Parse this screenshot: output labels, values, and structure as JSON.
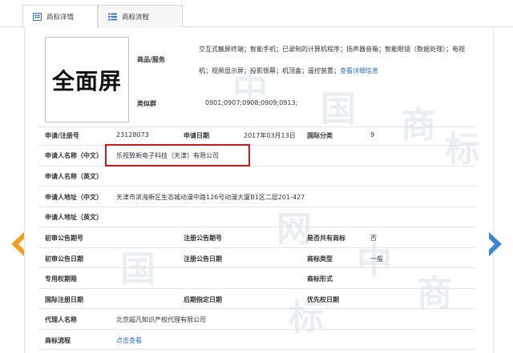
{
  "tabs": {
    "detail": "商标详情",
    "flow": "商标流程"
  },
  "logo_text": "全面屏",
  "watermark_chars": [
    "中",
    "国",
    "商",
    "标",
    "网",
    "中",
    "国",
    "商",
    "标"
  ],
  "goods": {
    "label": "商品/服务",
    "text": "交互式触屏终端；智能手机；已录制的计算机程序；扬声器音箱；智能眼镜（数据处理）；电视机；视频显示屏；投影银幕；机顶盒；遥控装置；",
    "link": "查看详细信息"
  },
  "similar_group": {
    "label": "类似群",
    "value": "0901;0907;0908;0909;0913;"
  },
  "fields": {
    "reg_no_label": "申请/注册号",
    "reg_no": "23128073",
    "apply_date_label": "申请日期",
    "apply_date": "2017年03月13日",
    "intl_class_label": "国际分类",
    "intl_class": "9",
    "applicant_cn_label": "申请人名称（中文）",
    "applicant_cn": "乐视致新电子科技（天津）有限公司",
    "applicant_en_label": "申请人名称（英文）",
    "applicant_en": "",
    "address_cn_label": "申请人地址（中文）",
    "address_cn": "天津市滨海新区生态城动漫中路126号动漫大厦B1区二层201-427",
    "address_en_label": "申请人地址（英文）",
    "address_en": "",
    "first_pub_no_label": "初审公告期号",
    "first_pub_no": "",
    "reg_pub_no_label": "注册公告期号",
    "reg_pub_no": "",
    "shared_label": "是否共有商标",
    "shared": "否",
    "first_pub_date_label": "初审公告日期",
    "first_pub_date": "",
    "reg_pub_date_label": "注册公告日期",
    "reg_pub_date": "",
    "mark_type_label": "商标类型",
    "mark_type": "一般",
    "exclusive_period_label": "专用权期限",
    "exclusive_period": "",
    "mark_form_label": "商标形式",
    "mark_form": "",
    "intl_reg_date_label": "国际注册日期",
    "intl_reg_date": "",
    "later_date_label": "后期指定日期",
    "later_date": "",
    "priority_date_label": "优先权日期",
    "priority_date": "",
    "agent_label": "代理人名称",
    "agent": "北京超凡知识产权代理有限公司",
    "flow_label": "商标流程",
    "flow_link": "点击查看"
  },
  "colors": {
    "accent": "#2a6fbf",
    "highlight": "#d9121b",
    "arrow_left": "#f0a020",
    "arrow_right": "#3a86d4"
  }
}
